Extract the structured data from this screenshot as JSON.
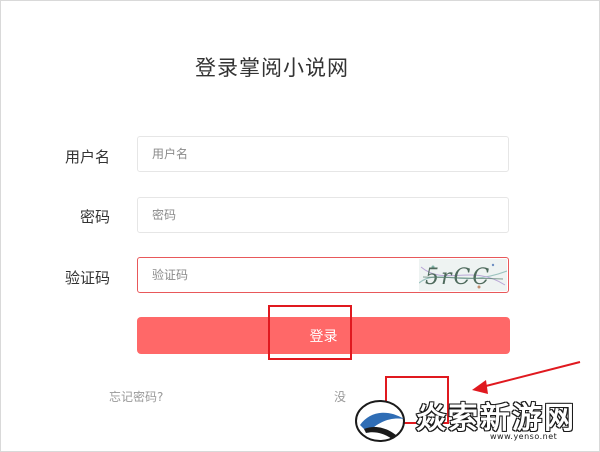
{
  "page": {
    "title": "登录掌阅小说网"
  },
  "form": {
    "username": {
      "label": "用户名",
      "placeholder": "用户名",
      "value": ""
    },
    "password": {
      "label": "密码",
      "placeholder": "密码",
      "value": ""
    },
    "captcha": {
      "label": "验证码",
      "placeholder": "验证码",
      "value": "",
      "image_text": "5rCC"
    },
    "submit_label": "登录"
  },
  "links": {
    "forgot_password": "忘记密码?",
    "register_partial": "没"
  },
  "watermark": {
    "title": "焱索新游网",
    "url": "www.yenso.net"
  },
  "colors": {
    "accent": "#ff6868",
    "error_border": "#e8585a",
    "highlight": "#e0191f"
  }
}
